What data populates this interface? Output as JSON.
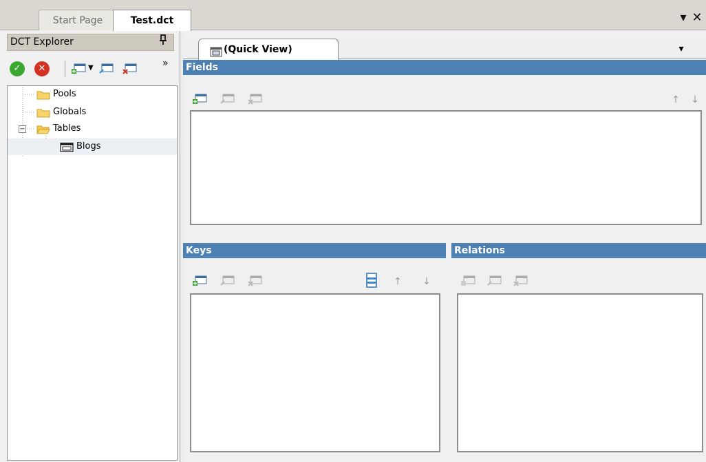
{
  "doc_tabs": [
    {
      "label": "Start Page",
      "active": false
    },
    {
      "label": "Test.dct",
      "active": true
    }
  ],
  "strip_controls": {
    "dropdown_glyph": "▾",
    "close_glyph": "✕"
  },
  "explorer": {
    "title": "DCT Explorer",
    "pin_glyph": "ⅎ",
    "overflow_glyph": "»",
    "tree": [
      {
        "label": "Pools",
        "icon": "folder-closed-icon"
      },
      {
        "label": "Globals",
        "icon": "folder-closed-icon"
      },
      {
        "label": "Tables",
        "icon": "folder-open-icon",
        "expanded": true
      },
      {
        "label": "Blogs",
        "icon": "table-icon",
        "selected": true
      }
    ],
    "expand_glyph": "−"
  },
  "main": {
    "quick_view_tab": "(Quick View)",
    "dropdown_glyph": "▾",
    "fields": {
      "title": "Fields"
    },
    "keys": {
      "title": "Keys"
    },
    "relations": {
      "title": "Relations"
    },
    "arrow_up": "↑",
    "arrow_down": "↓"
  },
  "colors": {
    "section_bar": "#4d80b3",
    "accept": "#3aa72f",
    "cancel": "#d33222"
  }
}
